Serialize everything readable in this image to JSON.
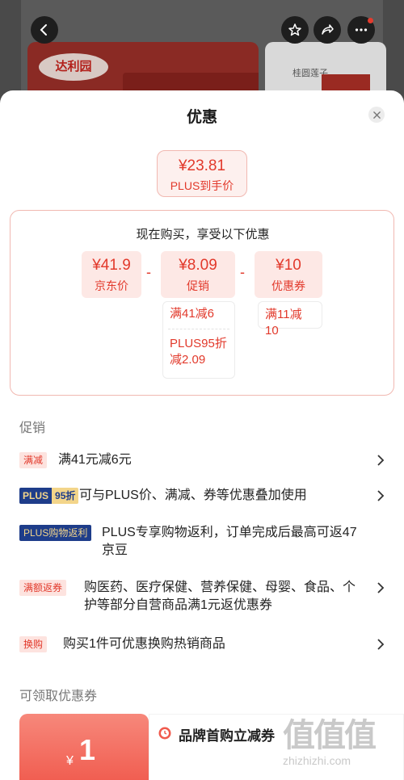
{
  "background": {
    "card1_logo": "达利园",
    "card2_label": "桂圆莲子"
  },
  "sheet": {
    "title": "优惠",
    "final_price": {
      "amount": "¥23.81",
      "label": "PLUS到手价"
    },
    "calc": {
      "heading": "现在购买，享受以下优惠",
      "items": [
        {
          "amount": "¥41.9",
          "label": "京东价"
        },
        {
          "amount": "¥8.09",
          "label": "促销"
        },
        {
          "amount": "¥10",
          "label": "优惠券"
        }
      ],
      "operators": [
        "-",
        "-"
      ],
      "promo_details": [
        "满41减6",
        "PLUS95折",
        "减2.09"
      ],
      "coupon_details": [
        "满11减10"
      ]
    },
    "promotions_title": "促销",
    "promotions": [
      {
        "tag": "满减",
        "text": "满41元减6元"
      },
      {
        "tag_a": "PLUS",
        "tag_b": "95折",
        "text": "可与PLUS价、满减、券等优惠叠加使用"
      },
      {
        "tag": "PLUS购物返利",
        "text_1": "PLUS专享购物返利，订单完成后最高可返47",
        "text_2": "京豆"
      },
      {
        "tag": "满额返券",
        "text_1": "购医药、医疗保健、营养保健、母婴、食品、个",
        "text_2": "护等部分自营商品满1元返优惠券"
      },
      {
        "tag": "换购",
        "text": "购买1件可优惠换购热销商品"
      }
    ],
    "coupons_title": "可领取优惠券",
    "coupon": {
      "yen": "¥",
      "amount": "1",
      "title": "品牌首购立减券"
    },
    "watermark": {
      "big": "值值值",
      "small": "zhizhizhi.com"
    }
  },
  "colors": {
    "accent": "#e2392b",
    "plus_blue": "#1e3d8a",
    "plus_gold": "#f3d58a"
  }
}
